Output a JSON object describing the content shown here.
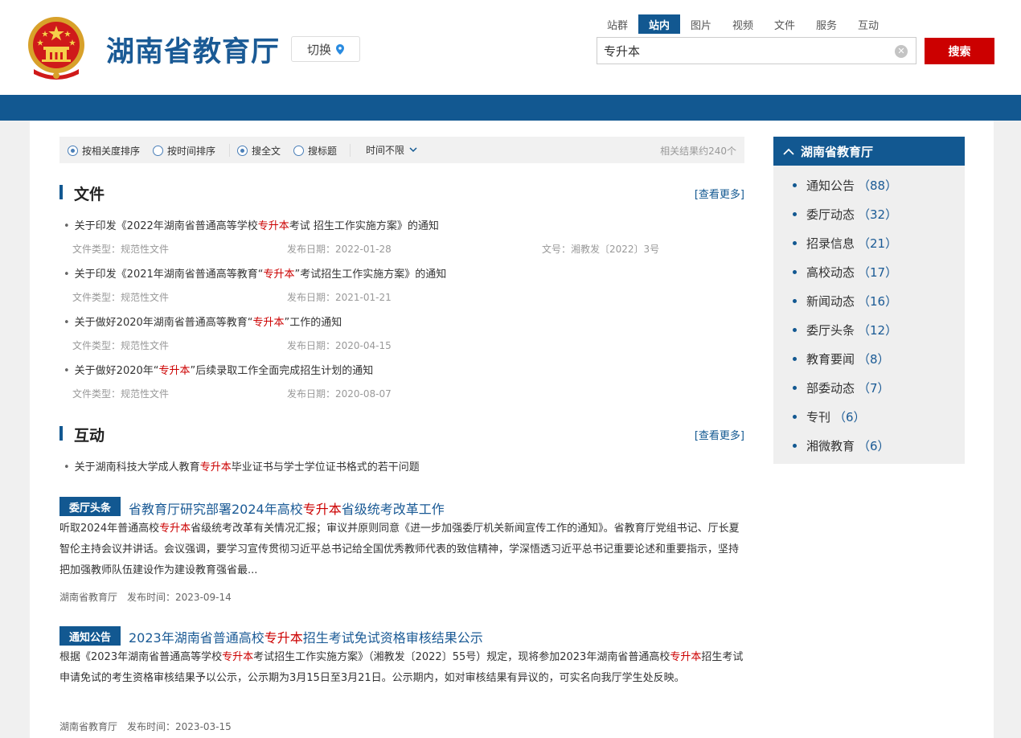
{
  "header": {
    "site_title": "湖南省教育厅",
    "switch_label": "切换",
    "scope_tabs": [
      {
        "label": "站群",
        "active": false
      },
      {
        "label": "站内",
        "active": true
      },
      {
        "label": "图片",
        "active": false
      },
      {
        "label": "视频",
        "active": false
      },
      {
        "label": "文件",
        "active": false
      },
      {
        "label": "服务",
        "active": false
      },
      {
        "label": "互动",
        "active": false
      }
    ],
    "search_value": "专升本",
    "search_button": "搜索",
    "clear_icon": "close-circle-icon",
    "location_icon": "map-pin-icon"
  },
  "filters": {
    "sort_relevance": "按相关度排序",
    "sort_time": "按时间排序",
    "scope_full": "搜全文",
    "scope_title": "搜标题",
    "time_range": "时间不限",
    "result_count": "相关结果约240个"
  },
  "sections": {
    "files": {
      "title": "文件",
      "more": "[查看更多]",
      "items": [
        {
          "pre": "关于印发《2022年湖南省普通高等学校",
          "hl": "专升本",
          "post": "考试 招生工作实施方案》的通知",
          "type": "文件类型：规范性文件",
          "date": "发布日期：2022-01-28",
          "docno": "文号：湘教发〔2022〕3号"
        },
        {
          "pre": "关于印发《2021年湖南省普通高等教育“",
          "hl": "专升本",
          "post": "”考试招生工作实施方案》的通知",
          "type": "文件类型：规范性文件",
          "date": "发布日期：2021-01-21",
          "docno": ""
        },
        {
          "pre": "关于做好2020年湖南省普通高等教育“",
          "hl": "专升本",
          "post": "”工作的通知",
          "type": "文件类型：规范性文件",
          "date": "发布日期：2020-04-15",
          "docno": ""
        },
        {
          "pre": "关于做好2020年“",
          "hl": "专升本",
          "post": "”后续录取工作全面完成招生计划的通知",
          "type": "文件类型：规范性文件",
          "date": "发布日期：2020-08-07",
          "docno": ""
        }
      ]
    },
    "interaction": {
      "title": "互动",
      "more": "[查看更多]",
      "items": [
        {
          "pre": "关于湖南科技大学成人教育",
          "hl": "专升本",
          "post": "毕业证书与学士学位证书格式的若干问题"
        }
      ]
    }
  },
  "news": [
    {
      "tag": "委厅头条",
      "title_pre": "省教育厅研究部署2024年高校",
      "title_hl": "专升本",
      "title_post": "省级统考改革工作",
      "sum_pre": "听取2024年普通高校",
      "sum_hl": "专升本",
      "sum_post": "省级统考改革有关情况汇报；审议并原则同意《进一步加强委厅机关新闻宣传工作的通知》。省教育厅党组书记、厅长夏智伦主持会议并讲话。会议强调，要学习宣传贯彻习近平总书记给全国优秀教师代表的致信精神，学深悟透习近平总书记重要论述和重要指示，坚持把加强教师队伍建设作为建设教育强省最...",
      "source": "湖南省教育厅",
      "time": "发布时间：2023-09-14"
    },
    {
      "tag": "通知公告",
      "title_pre": "2023年湖南省普通高校",
      "title_hl": "专升本",
      "title_post": "招生考试免试资格审核结果公示",
      "sum_pre": "根据《2023年湖南省普通高等学校",
      "sum_hl": "专升本",
      "sum_mid": "考试招生工作实施方案》（湘教发〔2022〕55号）规定，现将参加2023年湖南省普通高校",
      "sum_hl2": "专升本",
      "sum_post": "招生考试申请免试的考生资格审核结果予以公示，公示期为3月15日至3月21日。公示期内，如对审核结果有异议的，可实名向我厅学生处反映。",
      "source": "湖南省教育厅",
      "time": "发布时间：2023-03-15"
    }
  ],
  "sidebar": {
    "title": "湖南省教育厅",
    "items": [
      {
        "label": "通知公告",
        "count": "（88）"
      },
      {
        "label": "委厅动态",
        "count": "（32）"
      },
      {
        "label": "招录信息",
        "count": "（21）"
      },
      {
        "label": "高校动态",
        "count": "（17）"
      },
      {
        "label": "新闻动态",
        "count": "（16）"
      },
      {
        "label": "委厅头条",
        "count": "（12）"
      },
      {
        "label": "教育要闻",
        "count": "（8）"
      },
      {
        "label": "部委动态",
        "count": "（7）"
      },
      {
        "label": "专刊",
        "count": "（6）"
      },
      {
        "label": "湘微教育",
        "count": "（6）"
      }
    ]
  },
  "colors": {
    "brand_blue": "#125891",
    "accent_red": "#cc0000"
  }
}
